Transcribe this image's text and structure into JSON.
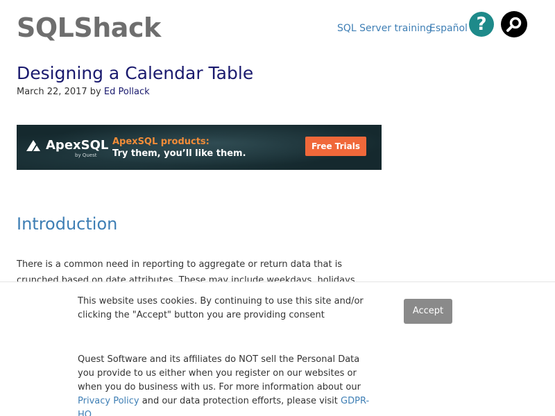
{
  "header": {
    "logo": "SQLShack",
    "nav": {
      "training": "SQL Server training",
      "espanol": "Español"
    },
    "help_glyph": "?",
    "icons": {
      "help": "help-question-icon",
      "search": "search-magnifier-icon"
    },
    "colors": {
      "logo": "#6e6e6e",
      "link": "#3f7fb5",
      "help_bg": "#1e8a8a",
      "search_bg": "#000000"
    }
  },
  "article": {
    "title": "Designing a Calendar Table",
    "date": "March 22, 2017",
    "by": "by",
    "author": "Ed Pollack",
    "section_heading": "Introduction",
    "intro_text": "There is a common need in reporting to aggregate or return data that is crunched based on date attributes. These may include weekdays, holidays, quarters, or time of"
  },
  "banner": {
    "logo": "ApexSQL",
    "byline": "by Quest",
    "headline": "ApexSQL products:",
    "tagline": "Try them, you’ll like them.",
    "cta": "Free Trials",
    "colors": {
      "background": "#15292e",
      "headline": "#f28c38",
      "cta": "#f0683a"
    }
  },
  "cookie_banner": {
    "text": "This website uses cookies. By continuing to use this site and/or clicking the \"Accept\" button you are providing consent",
    "accept_label": "Accept",
    "privacy_text_1": "Quest Software and its affiliates do NOT sell the Personal Data you provide to us either when you register on our websites or when you do business with us. For more information about our",
    "privacy_link": "Privacy Policy",
    "privacy_text_2": "and our data protection efforts, please visit",
    "gdpr_link": "GDPR-HQ"
  }
}
